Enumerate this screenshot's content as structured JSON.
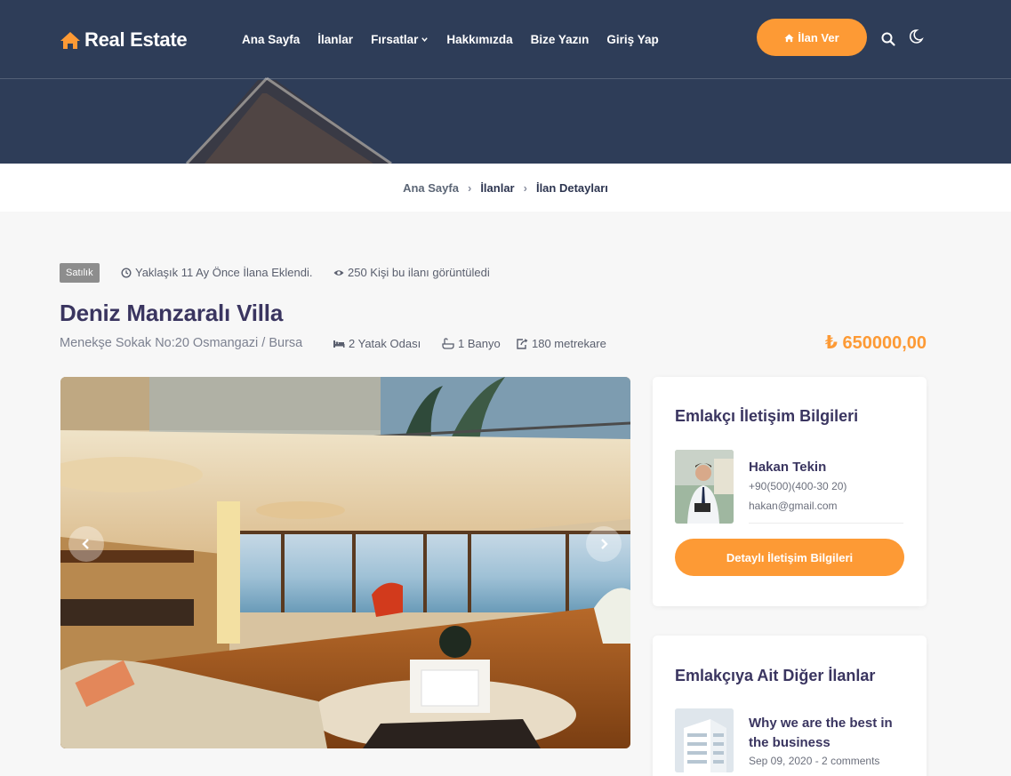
{
  "header": {
    "logo_text": "Real Estate",
    "nav": [
      {
        "label": "Ana Sayfa"
      },
      {
        "label": "İlanlar"
      },
      {
        "label": "Fırsatlar"
      },
      {
        "label": "Hakkımızda"
      },
      {
        "label": "Bize Yazın"
      },
      {
        "label": "Giriş Yap"
      }
    ],
    "cta_label": "İlan Ver"
  },
  "breadcrumb": [
    "Ana Sayfa",
    "İlanlar",
    "İlan Detayları"
  ],
  "listing": {
    "status_badge": "Satılık",
    "added_text": "Yaklaşık 11 Ay Önce İlana Eklendi.",
    "views_text": "250 Kişi bu ilanı görüntüledi",
    "title": "Deniz Manzaralı Villa",
    "address": "Menekşe Sokak No:20 Osmangazi / Bursa",
    "bedrooms": "2 Yatak Odası",
    "bathrooms": "1 Banyo",
    "area": "180 metrekare",
    "price": "₺ 650000,00"
  },
  "agent_card": {
    "title": "Emlakçı İletişim Bilgileri",
    "name": "Hakan Tekin",
    "phone": "+90(500)(400-30 20)",
    "email": "hakan@gmail.com",
    "button_label": "Detaylı İletişim Bilgileri"
  },
  "other_listings_card": {
    "title": "Emlakçıya Ait Diğer İlanlar",
    "posts": [
      {
        "title": "Why we are the best in the business",
        "meta": "Sep 09, 2020 - 2 comments"
      }
    ]
  },
  "colors": {
    "accent": "#fd9a35",
    "header_bg": "#2e3d58",
    "title": "#3a3560"
  }
}
